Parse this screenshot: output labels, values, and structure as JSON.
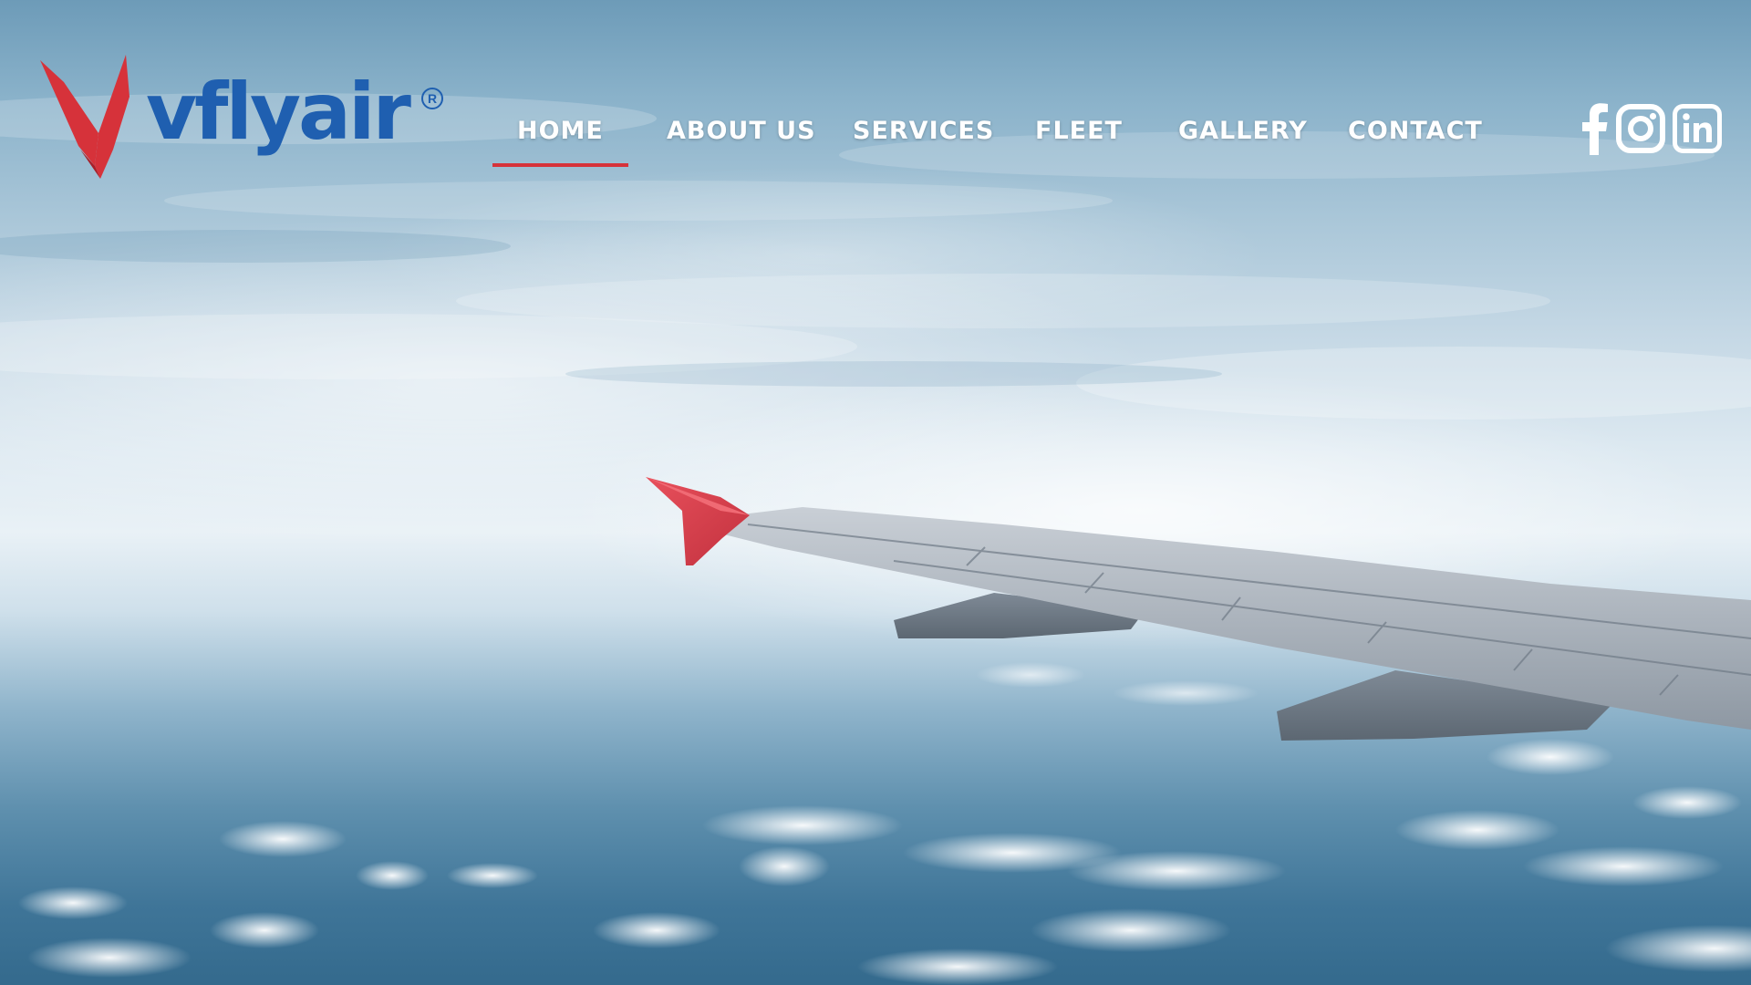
{
  "brand": {
    "name": "vflyair",
    "registered_mark": "R",
    "accent_color": "#d6323a",
    "brand_blue": "#1f5fb0"
  },
  "nav": {
    "active": "HOME",
    "items": [
      {
        "label": "HOME"
      },
      {
        "label": "ABOUT US"
      },
      {
        "label": "SERVICES"
      },
      {
        "label": "FLEET"
      },
      {
        "label": "GALLERY"
      },
      {
        "label": "CONTACT"
      }
    ]
  },
  "social": {
    "icons": [
      "facebook-icon",
      "instagram-icon",
      "linkedin-icon"
    ]
  },
  "hero": {
    "background": "airplane-wing-over-clouds"
  }
}
